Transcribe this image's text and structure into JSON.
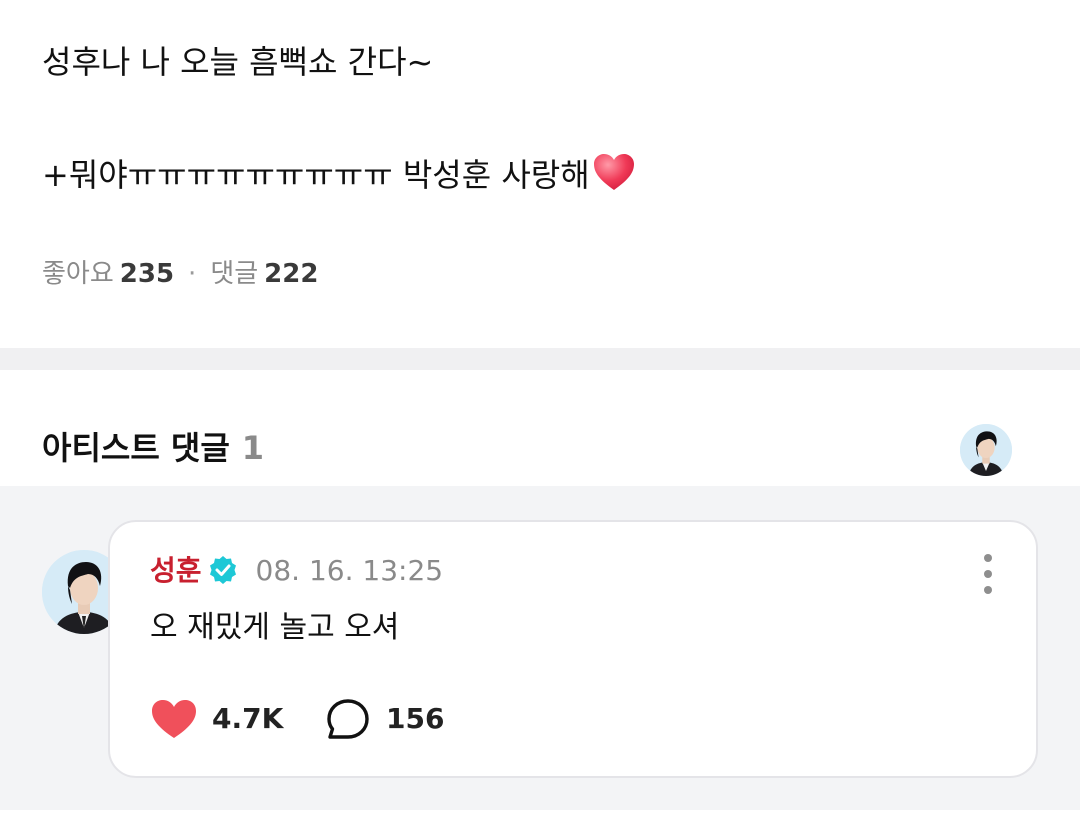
{
  "post": {
    "line1": "성후나 나 오늘 흠뻑쇼 간다~",
    "line2": "+뭐야ㅠㅠㅠㅠㅠㅠㅠㅠㅠ 박성훈 사랑해",
    "line2_emoji": "heart-emoji",
    "likes_label": "좋아요",
    "likes_count": "235",
    "separator": "·",
    "comments_label": "댓글",
    "comments_count": "222"
  },
  "artist_section": {
    "title": "아티스트 댓글",
    "count": "1"
  },
  "comment": {
    "author": "성훈",
    "verified_icon": "verified-badge-icon",
    "timestamp": "08. 16. 13:25",
    "text": "오 재밌게 놀고 오셔",
    "likes": "4.7K",
    "replies": "156"
  },
  "colors": {
    "author": "#c8202f",
    "verified": "#1ec8d6",
    "like_heart": "#f0505b",
    "section_bg": "#f3f4f6"
  }
}
